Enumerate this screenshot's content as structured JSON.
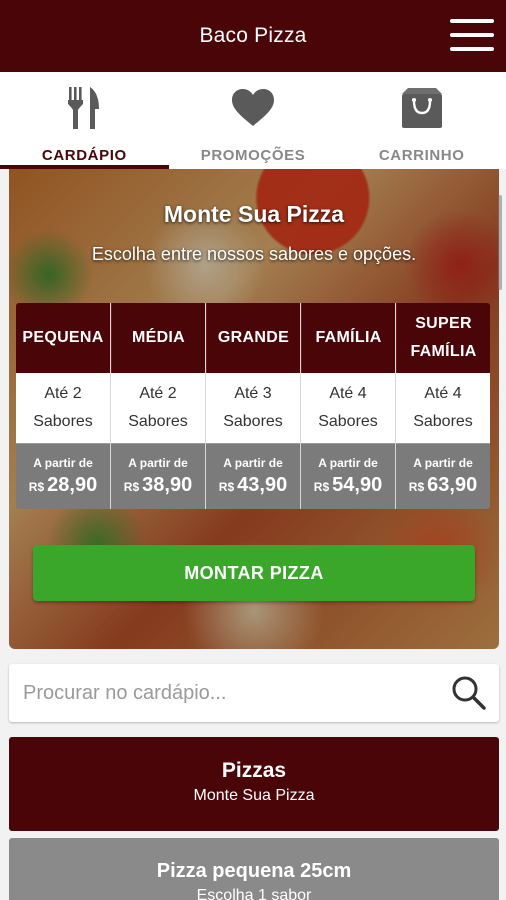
{
  "app": {
    "title": "Baco Pizza"
  },
  "tabs": [
    {
      "label": "CARDÁPIO",
      "icon": "fork-knife-icon",
      "active": true
    },
    {
      "label": "PROMOÇÕES",
      "icon": "heart-icon",
      "active": false
    },
    {
      "label": "CARRINHO",
      "icon": "shopping-bag-icon",
      "active": false
    }
  ],
  "hero": {
    "title": "Monte Sua Pizza",
    "subtitle": "Escolha entre nossos sabores e opções.",
    "sizes": [
      {
        "name_line1": "PEQUENA",
        "name_line2": "",
        "flavors_line1": "Até 2",
        "flavors_line2": "Sabores",
        "from_label": "A partir de",
        "currency": "R$",
        "price": "28,90"
      },
      {
        "name_line1": "MÉDIA",
        "name_line2": "",
        "flavors_line1": "Até 2",
        "flavors_line2": "Sabores",
        "from_label": "A partir de",
        "currency": "R$",
        "price": "38,90"
      },
      {
        "name_line1": "GRANDE",
        "name_line2": "",
        "flavors_line1": "Até 3",
        "flavors_line2": "Sabores",
        "from_label": "A partir de",
        "currency": "R$",
        "price": "43,90"
      },
      {
        "name_line1": "FAMÍLIA",
        "name_line2": "",
        "flavors_line1": "Até 4",
        "flavors_line2": "Sabores",
        "from_label": "A partir de",
        "currency": "R$",
        "price": "54,90"
      },
      {
        "name_line1": "SUPER",
        "name_line2": "FAMÍLIA",
        "flavors_line1": "Até 4",
        "flavors_line2": "Sabores",
        "from_label": "A partir de",
        "currency": "R$",
        "price": "63,90"
      }
    ],
    "button_label": "MONTAR PIZZA"
  },
  "search": {
    "placeholder": "Procurar no cardápio...",
    "value": ""
  },
  "categories": [
    {
      "title": "Pizzas",
      "subtitle": "Monte Sua Pizza"
    },
    {
      "title": "Pizza pequena 25cm",
      "subtitle": "Escolha 1 sabor"
    }
  ],
  "colors": {
    "brand": "#4a0508",
    "accent_green": "#3aa62a",
    "price_gray": "#7b7b7b",
    "inactive_gray": "#8a8a8a"
  }
}
